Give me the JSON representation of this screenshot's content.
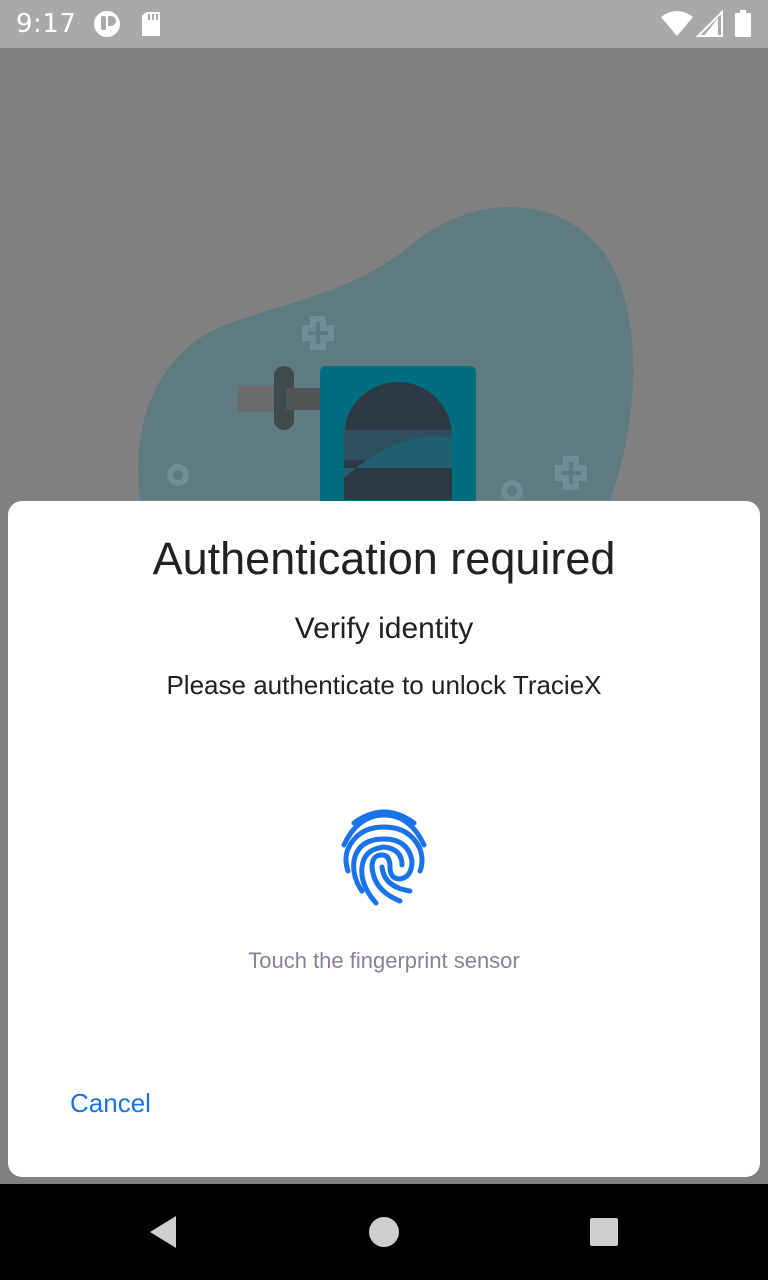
{
  "status_bar": {
    "time": "9:17",
    "icons": [
      "tracie-notification-icon",
      "sd-card-icon",
      "wifi-icon",
      "signal-icon",
      "battery-icon"
    ]
  },
  "background": {
    "blob_color": "#5f7a80",
    "device_color": "#006e80"
  },
  "dialog": {
    "title": "Authentication required",
    "subtitle": "Verify identity",
    "description": "Please authenticate to unlock TracieX",
    "hint": "Touch the fingerprint sensor",
    "cancel_label": "Cancel",
    "accent_color": "#1a73e8"
  },
  "nav_bar": {
    "buttons": [
      "back-icon",
      "home-icon",
      "recents-icon"
    ]
  }
}
